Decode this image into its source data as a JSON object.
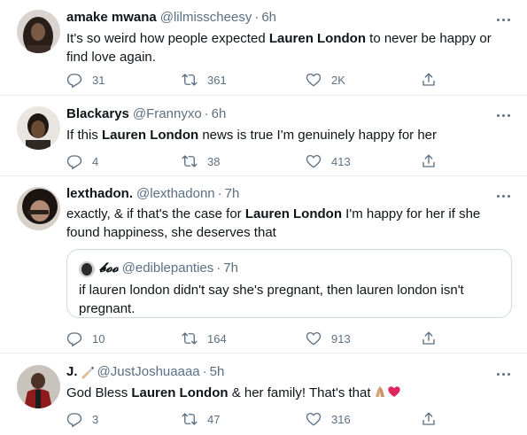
{
  "tweets": [
    {
      "display_name": "amake mwana",
      "handle": "@lilmisscheesy",
      "sep": "·",
      "time": "6h",
      "text": [
        {
          "t": "It's so weird how people expected "
        },
        {
          "t": "Lauren London",
          "b": true
        },
        {
          "t": " to never be happy or find love again."
        }
      ],
      "replies": "31",
      "retweets": "361",
      "likes": "2K"
    },
    {
      "display_name": "Blackarys",
      "handle": "@Frannyxo",
      "sep": "·",
      "time": "6h",
      "text": [
        {
          "t": "If this "
        },
        {
          "t": "Lauren London",
          "b": true
        },
        {
          "t": " news is true I'm genuinely happy for her"
        }
      ],
      "replies": "4",
      "retweets": "38",
      "likes": "413"
    },
    {
      "display_name": "lexthadon.",
      "handle": "@lexthadonn",
      "sep": "·",
      "time": "7h",
      "text": [
        {
          "t": "exactly, & if that's the case for "
        },
        {
          "t": "Lauren London",
          "b": true
        },
        {
          "t": " I'm happy for her if she found happiness, she deserves that"
        }
      ],
      "quoted": {
        "display_name": "𝓫𝓸𝓸",
        "handle": "@ediblepanties",
        "sep": "·",
        "time": "7h",
        "text": "if lauren london didn't say she's pregnant, then lauren london isn't pregnant."
      },
      "replies": "10",
      "retweets": "164",
      "likes": "913"
    },
    {
      "display_name": "J.",
      "handle": "@JustJoshuaaaa",
      "sep": "·",
      "time": "5h",
      "text": [
        {
          "t": "God Bless "
        },
        {
          "t": "Lauren London",
          "b": true
        },
        {
          "t": " & her family!  That's that"
        }
      ],
      "replies": "3",
      "retweets": "47",
      "likes": "316"
    }
  ],
  "icons": {
    "reply": "reply-icon",
    "retweet": "retweet-icon",
    "like": "heart-icon",
    "share": "share-icon",
    "more": "more-icon",
    "name_badge": "writing-hand-emoji",
    "emoji_end": [
      "folded-hands-emoji",
      "red-heart-emoji"
    ]
  },
  "colors": {
    "text": "#0f1419",
    "secondary": "#5b7083",
    "border": "#e6ecf0",
    "heart_emoji": "#e0245e"
  }
}
